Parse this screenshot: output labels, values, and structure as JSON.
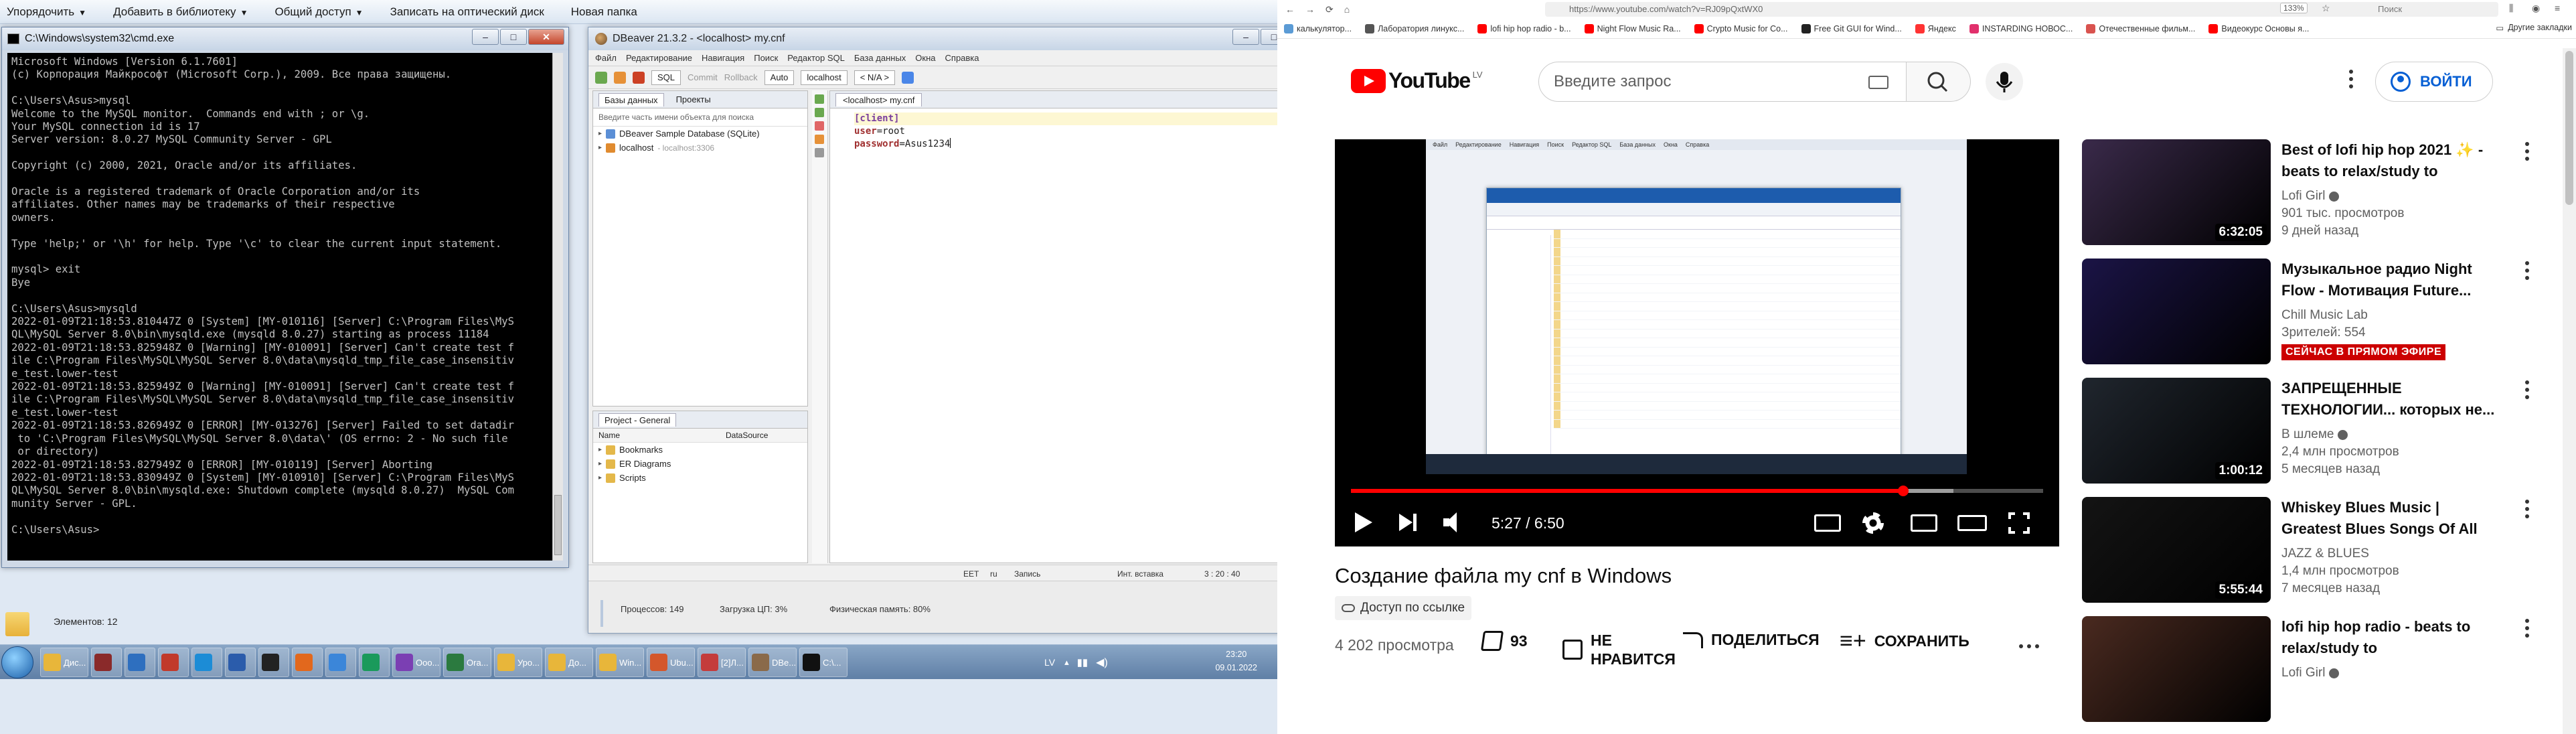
{
  "explorer_menu": {
    "organize": "Упорядочить",
    "add_library": "Добавить в библиотеку",
    "share": "Общий доступ",
    "burn": "Записать на оптический диск",
    "new_folder": "Новая папка"
  },
  "cmd": {
    "title": "C:\\Windows\\system32\\cmd.exe",
    "lines": [
      "Microsoft Windows [Version 6.1.7601]",
      "(c) Корпорация Майкрософт (Microsoft Corp.), 2009. Все права защищены.",
      "",
      "C:\\Users\\Asus>mysql",
      "Welcome to the MySQL monitor.  Commands end with ; or \\g.",
      "Your MySQL connection id is 17",
      "Server version: 8.0.27 MySQL Community Server - GPL",
      "",
      "Copyright (c) 2000, 2021, Oracle and/or its affiliates.",
      "",
      "Oracle is a registered trademark of Oracle Corporation and/or its",
      "affiliates. Other names may be trademarks of their respective",
      "owners.",
      "",
      "Type 'help;' or '\\h' for help. Type '\\c' to clear the current input statement.",
      "",
      "mysql> exit",
      "Bye",
      "",
      "C:\\Users\\Asus>mysqld",
      "2022-01-09T21:18:53.810447Z 0 [System] [MY-010116] [Server] C:\\Program Files\\MyS",
      "QL\\MySQL Server 8.0\\bin\\mysqld.exe (mysqld 8.0.27) starting as process 11184",
      "2022-01-09T21:18:53.825948Z 0 [Warning] [MY-010091] [Server] Can't create test f",
      "ile C:\\Program Files\\MySQL\\MySQL Server 8.0\\data\\mysqld_tmp_file_case_insensitiv",
      "e_test.lower-test",
      "2022-01-09T21:18:53.825949Z 0 [Warning] [MY-010091] [Server] Can't create test f",
      "ile C:\\Program Files\\MySQL\\MySQL Server 8.0\\data\\mysqld_tmp_file_case_insensitiv",
      "e_test.lower-test",
      "2022-01-09T21:18:53.826949Z 0 [ERROR] [MY-013276] [Server] Failed to set datadir",
      " to 'C:\\Program Files\\MySQL\\MySQL Server 8.0\\data\\' (OS errno: 2 - No such file",
      " or directory)",
      "2022-01-09T21:18:53.827949Z 0 [ERROR] [MY-010119] [Server] Aborting",
      "2022-01-09T21:18:53.830949Z 0 [System] [MY-010910] [Server] C:\\Program Files\\MyS",
      "QL\\MySQL Server 8.0\\bin\\mysqld.exe: Shutdown complete (mysqld 8.0.27)  MySQL Com",
      "munity Server - GPL.",
      "",
      "C:\\Users\\Asus>"
    ]
  },
  "dbeaver": {
    "title": "DBeaver 21.3.2 - <localhost> my.cnf",
    "menu": [
      "Файл",
      "Редактирование",
      "Навигация",
      "Поиск",
      "Редактор SQL",
      "База данных",
      "Окна",
      "Справка"
    ],
    "toolbar": {
      "sql": "SQL",
      "commit": "Commit",
      "rollback": "Rollback",
      "auto": "Auto",
      "connection": "localhost",
      "schema": "< N/A >"
    },
    "nav_tabs": [
      "Базы данных",
      "Проекты"
    ],
    "filter_placeholder": "Введите часть имени объекта для поиска",
    "tree": [
      {
        "label": "DBeaver Sample Database (SQLite)",
        "meta": ""
      },
      {
        "label": "localhost",
        "meta": "- localhost:3306"
      }
    ],
    "project_tab": "Project - General",
    "project_cols": [
      "Name",
      "DataSource"
    ],
    "project_items": [
      "Bookmarks",
      "ER Diagrams",
      "Scripts"
    ],
    "editor_tab": "<localhost> my.cnf",
    "code": {
      "section": "[client]",
      "user_key": "user",
      "user_val": "root",
      "pw_key": "password",
      "pw_val": "Asus1234"
    },
    "status": {
      "eet": "EET",
      "ru": "ru",
      "mode": "Запись",
      "insert": "Инт. вставка",
      "pos": "3 : 20 : 40"
    },
    "bottom": {
      "processes": "Процессов: 149",
      "cpu": "Загрузка ЦП: 3%",
      "memory": "Физическая память: 80%"
    }
  },
  "explorer_status": {
    "elements": "Элементов: 12"
  },
  "taskbar": {
    "items": [
      {
        "label": "Дис...",
        "color": "#e8b63a"
      },
      {
        "label": "",
        "color": "#8a2a2a"
      },
      {
        "label": "",
        "color": "#2e6fbf"
      },
      {
        "label": "",
        "color": "#c13a2b"
      },
      {
        "label": "",
        "color": "#1c8cd6"
      },
      {
        "label": "",
        "color": "#2b5cab"
      },
      {
        "label": "",
        "color": "#222222"
      },
      {
        "label": "",
        "color": "#e2681d"
      },
      {
        "label": "",
        "color": "#3b86d9"
      },
      {
        "label": "",
        "color": "#1a9a5b"
      },
      {
        "label": "Ооо...",
        "color": "#7b3fb3"
      },
      {
        "label": "Ora...",
        "color": "#2b7a3f"
      },
      {
        "label": "Уро...",
        "color": "#e8b63a"
      },
      {
        "label": "До...",
        "color": "#e8b63a"
      },
      {
        "label": "Win...",
        "color": "#e8b63a"
      },
      {
        "label": "Ubu...",
        "color": "#d4572b"
      },
      {
        "label": "[2]Л...",
        "color": "#c43c3c"
      },
      {
        "label": "DBe...",
        "color": "#8a6a4a"
      },
      {
        "label": "C:\\...",
        "color": "#111111"
      }
    ],
    "lang": "LV",
    "time": "23:20",
    "date": "09.01.2022"
  },
  "browser": {
    "url": "https://www.youtube.com/watch?v=RJ09pQxtWX0",
    "zoom": "133%",
    "search_placeholder": "Поиск",
    "bookmarks": [
      {
        "label": "калькулятор...",
        "color": "#5b9bd5"
      },
      {
        "label": "Лаборатория линукс...",
        "color": "#555555"
      },
      {
        "label": "lofi hip hop radio - b...",
        "color": "#ff0000"
      },
      {
        "label": "Night Flow Music Ra...",
        "color": "#ff0000"
      },
      {
        "label": "Crypto Music for Co...",
        "color": "#ff0000"
      },
      {
        "label": "Free Git GUI for Wind...",
        "color": "#222222"
      },
      {
        "label": "Яндекс",
        "color": "#ff3333"
      },
      {
        "label": "INSTARDING НОВОС...",
        "color": "#e1306c"
      },
      {
        "label": "Отечественные фильм...",
        "color": "#d9534f"
      },
      {
        "label": "Видеокурс Основы я...",
        "color": "#ff0000"
      }
    ],
    "other_bookmarks": "Другие закладки"
  },
  "youtube": {
    "logo_text": "YouTube",
    "country": "LV",
    "search_placeholder": "Введите запрос",
    "signin": "ВОЙТИ",
    "player": {
      "time": "5:27 / 6:50",
      "progress": 0.798,
      "buffer": 0.87
    },
    "video_title": "Создание файла my cnf в Windows",
    "access": "Доступ по ссылке",
    "views": "4 202 просмотра",
    "likes": "93",
    "dislike": "НЕ НРАВИТСЯ",
    "share": "ПОДЕЛИТЬСЯ",
    "save": "СОХРАНИТЬ",
    "recommendations": [
      {
        "title": "Best of lofi hip hop 2021 ✨ - beats to relax/study to",
        "channel": "Lofi Girl",
        "verified": true,
        "meta": "901 тыс. просмотров",
        "meta2": "9 дней назад",
        "duration": "6:32:05",
        "live": "",
        "bg": "#3a2a4a"
      },
      {
        "title": "Музыкальное радио Night Flow - Мотивация Future...",
        "channel": "Chill Music Lab",
        "verified": false,
        "meta": "Зрителей: 554",
        "meta2": "",
        "duration": "",
        "live": "СЕЙЧАС В ПРЯМОМ ЭФИРЕ",
        "bg": "#1b1446"
      },
      {
        "title": "ЗАПРЕЩЕННЫЕ ТЕХНОЛОГИИ... которых не...",
        "channel": "В шлеме",
        "verified": true,
        "meta": "2,4 млн просмотров",
        "meta2": "5 месяцев назад",
        "duration": "1:00:12",
        "live": "",
        "bg": "#20262e"
      },
      {
        "title": "Whiskey Blues Music | Greatest Blues Songs Of All Time | Slow...",
        "channel": "JAZZ & BLUES",
        "verified": false,
        "meta": "1,4 млн просмотров",
        "meta2": "7 месяцев назад",
        "duration": "5:55:44",
        "live": "",
        "bg": "#141414"
      },
      {
        "title": "lofi hip hop radio - beats to relax/study to",
        "channel": "Lofi Girl",
        "verified": true,
        "meta": "",
        "meta2": "",
        "duration": "",
        "live": "",
        "bg": "#4a2a20"
      }
    ]
  }
}
